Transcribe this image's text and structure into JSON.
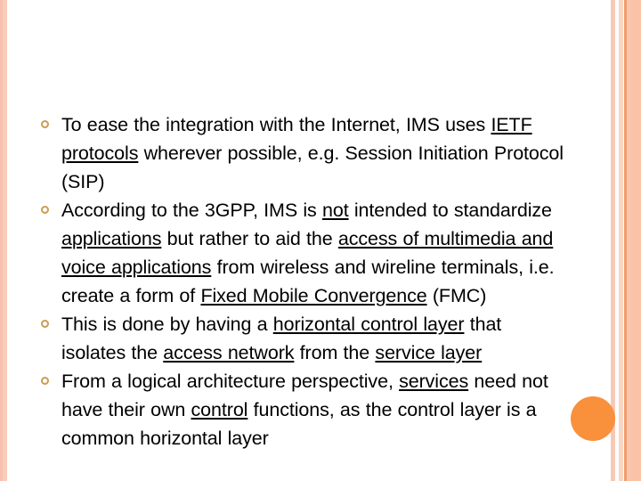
{
  "slide": {
    "background_color": "#ffffff",
    "accent_color": "#f8903c",
    "bullet_marker_color": "#cf9a52",
    "stripe_colors": [
      "#f6c2ad",
      "#f8cdba",
      "#f6c9b5",
      "#f9d6c4",
      "#ef9d6e",
      "#f8c6ac",
      "#fac3a8"
    ]
  },
  "body": {
    "bullets": [
      {
        "id": "bullet-1",
        "segments": [
          {
            "text": "To ease the integration with the Internet, IMS uses ",
            "underline": false
          },
          {
            "text": "IETF protocols",
            "underline": true
          },
          {
            "text": " wherever possible, e.g. Session Initiation Protocol (SIP)",
            "underline": false
          }
        ]
      },
      {
        "id": "bullet-2",
        "segments": [
          {
            "text": "According to the 3GPP, IMS is ",
            "underline": false
          },
          {
            "text": "not",
            "underline": true
          },
          {
            "text": " intended to standardize ",
            "underline": false
          },
          {
            "text": "applications",
            "underline": true
          },
          {
            "text": " but rather to aid the ",
            "underline": false
          },
          {
            "text": "access of multimedia and voice applications",
            "underline": true
          },
          {
            "text": " from wireless and wireline terminals, i.e. create a form of ",
            "underline": false
          },
          {
            "text": "Fixed Mobile Convergence",
            "underline": true
          },
          {
            "text": " (FMC)",
            "underline": false
          }
        ]
      },
      {
        "id": "bullet-3",
        "segments": [
          {
            "text": "This is done by having a ",
            "underline": false
          },
          {
            "text": "horizontal control layer",
            "underline": true
          },
          {
            "text": " that isolates the ",
            "underline": false
          },
          {
            "text": "access network",
            "underline": true
          },
          {
            "text": " from the ",
            "underline": false
          },
          {
            "text": "service layer",
            "underline": true
          }
        ]
      },
      {
        "id": "bullet-4",
        "segments": [
          {
            "text": "From a logical architecture perspective, ",
            "underline": false
          },
          {
            "text": "services",
            "underline": true
          },
          {
            "text": " need not have their own ",
            "underline": false
          },
          {
            "text": "control",
            "underline": true
          },
          {
            "text": " functions, as the control layer is a common horizontal layer",
            "underline": false
          }
        ]
      }
    ]
  }
}
